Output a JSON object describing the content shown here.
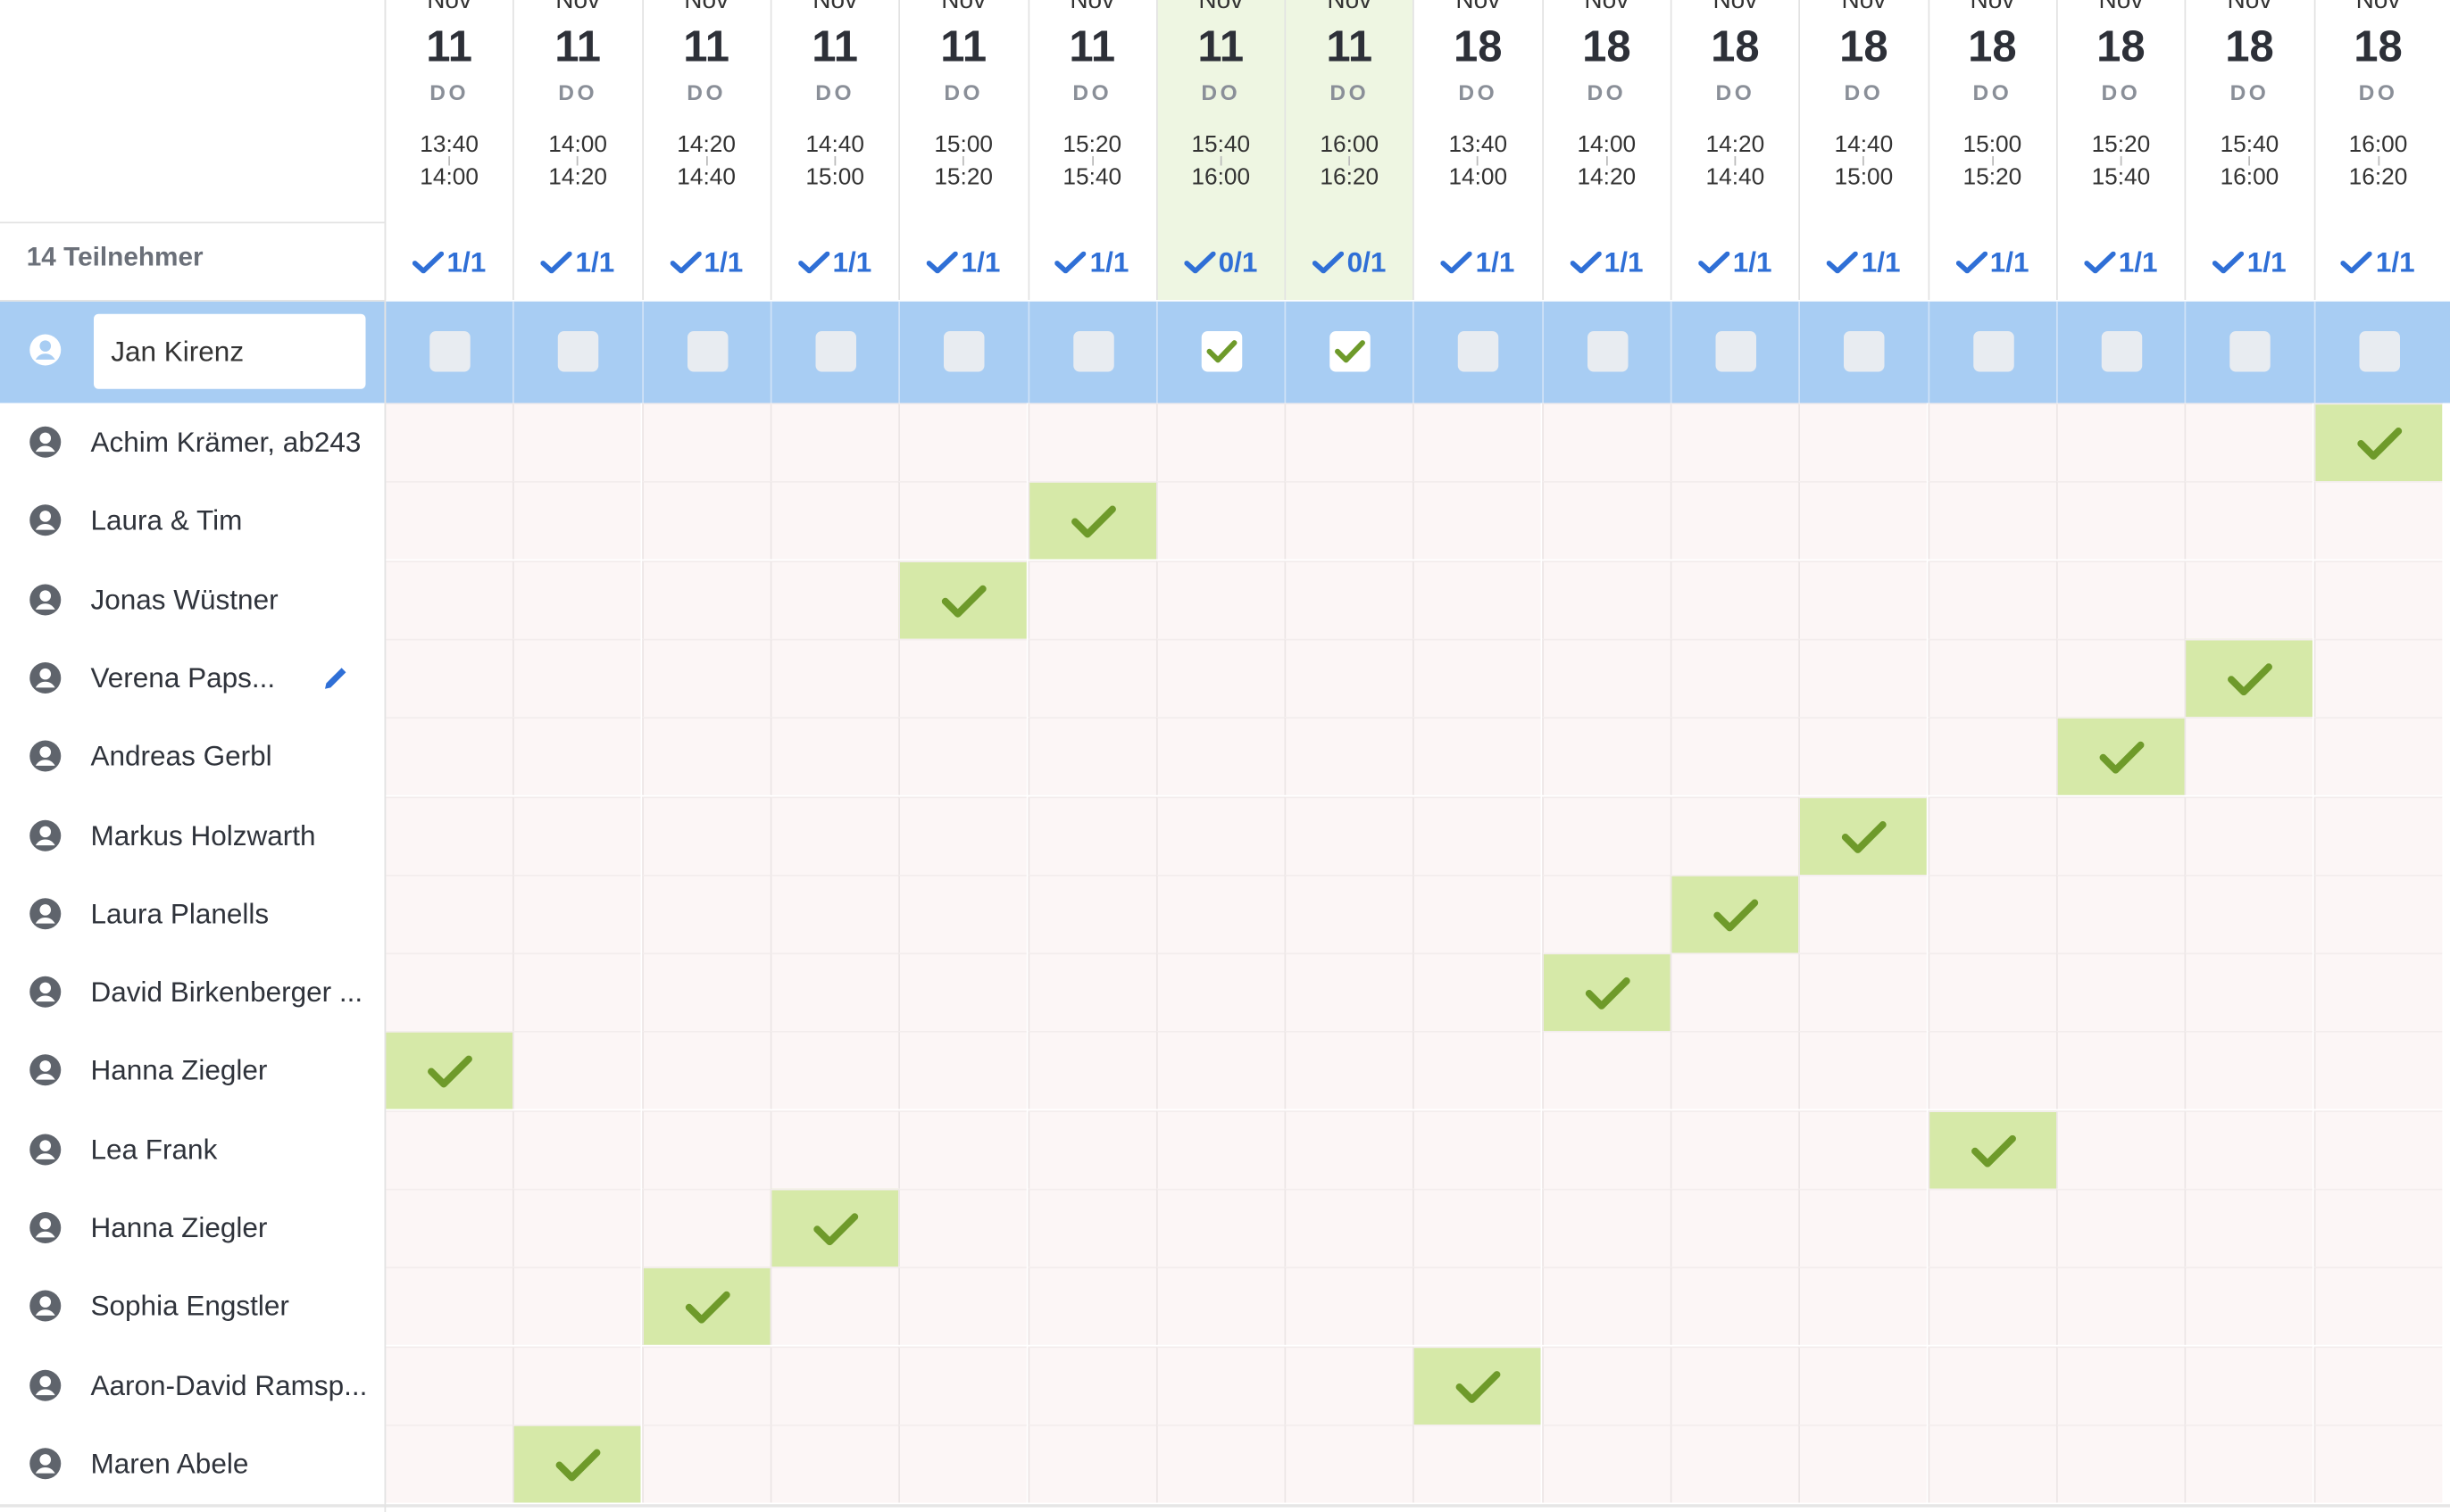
{
  "columns": [
    {
      "month": "Nov",
      "day": "11",
      "weekday": "DO",
      "start": "13:40",
      "end": "14:00",
      "count": "1/1",
      "highlight": false,
      "mine": false
    },
    {
      "month": "Nov",
      "day": "11",
      "weekday": "DO",
      "start": "14:00",
      "end": "14:20",
      "count": "1/1",
      "highlight": false,
      "mine": false
    },
    {
      "month": "Nov",
      "day": "11",
      "weekday": "DO",
      "start": "14:20",
      "end": "14:40",
      "count": "1/1",
      "highlight": false,
      "mine": false
    },
    {
      "month": "Nov",
      "day": "11",
      "weekday": "DO",
      "start": "14:40",
      "end": "15:00",
      "count": "1/1",
      "highlight": false,
      "mine": false
    },
    {
      "month": "Nov",
      "day": "11",
      "weekday": "DO",
      "start": "15:00",
      "end": "15:20",
      "count": "1/1",
      "highlight": false,
      "mine": false
    },
    {
      "month": "Nov",
      "day": "11",
      "weekday": "DO",
      "start": "15:20",
      "end": "15:40",
      "count": "1/1",
      "highlight": false,
      "mine": false
    },
    {
      "month": "Nov",
      "day": "11",
      "weekday": "DO",
      "start": "15:40",
      "end": "16:00",
      "count": "0/1",
      "highlight": true,
      "mine": true
    },
    {
      "month": "Nov",
      "day": "11",
      "weekday": "DO",
      "start": "16:00",
      "end": "16:20",
      "count": "0/1",
      "highlight": true,
      "mine": true
    },
    {
      "month": "Nov",
      "day": "18",
      "weekday": "DO",
      "start": "13:40",
      "end": "14:00",
      "count": "1/1",
      "highlight": false,
      "mine": false
    },
    {
      "month": "Nov",
      "day": "18",
      "weekday": "DO",
      "start": "14:00",
      "end": "14:20",
      "count": "1/1",
      "highlight": false,
      "mine": false
    },
    {
      "month": "Nov",
      "day": "18",
      "weekday": "DO",
      "start": "14:20",
      "end": "14:40",
      "count": "1/1",
      "highlight": false,
      "mine": false
    },
    {
      "month": "Nov",
      "day": "18",
      "weekday": "DO",
      "start": "14:40",
      "end": "15:00",
      "count": "1/1",
      "highlight": false,
      "mine": false
    },
    {
      "month": "Nov",
      "day": "18",
      "weekday": "DO",
      "start": "15:00",
      "end": "15:20",
      "count": "1/1",
      "highlight": false,
      "mine": false
    },
    {
      "month": "Nov",
      "day": "18",
      "weekday": "DO",
      "start": "15:20",
      "end": "15:40",
      "count": "1/1",
      "highlight": false,
      "mine": false
    },
    {
      "month": "Nov",
      "day": "18",
      "weekday": "DO",
      "start": "15:40",
      "end": "16:00",
      "count": "1/1",
      "highlight": false,
      "mine": false
    },
    {
      "month": "Nov",
      "day": "18",
      "weekday": "DO",
      "start": "16:00",
      "end": "16:20",
      "count": "1/1",
      "highlight": false,
      "mine": false
    }
  ],
  "participants_label": "14 Teilnehmer",
  "me": {
    "name": "Jan Kirenz",
    "icon": "user-icon"
  },
  "participants": [
    {
      "name": "Achim Krämer, ab243",
      "slot": 15
    },
    {
      "name": "Laura & Tim",
      "slot": 5
    },
    {
      "name": "Jonas Wüstner",
      "slot": 4
    },
    {
      "name": "Verena Paps...",
      "slot": 14,
      "editable": true
    },
    {
      "name": "Andreas Gerbl",
      "slot": 13
    },
    {
      "name": "Markus Holzwarth",
      "slot": 11
    },
    {
      "name": "Laura Planells",
      "slot": 10
    },
    {
      "name": "David Birkenberger ...",
      "slot": 9
    },
    {
      "name": "Hanna Ziegler",
      "slot": 0
    },
    {
      "name": "Lea Frank",
      "slot": 12
    },
    {
      "name": "Hanna Ziegler",
      "slot": 3
    },
    {
      "name": "Sophia Engstler",
      "slot": 2
    },
    {
      "name": "Aaron-David Ramsp...",
      "slot": 8
    },
    {
      "name": "Maren Abele",
      "slot": 1
    }
  ],
  "colors": {
    "accent": "#2f6fd6",
    "yes": "#d6e9a8",
    "check": "#6e9a2a",
    "my_row": "#a8cdf3",
    "highlight": "#eef6e2"
  }
}
